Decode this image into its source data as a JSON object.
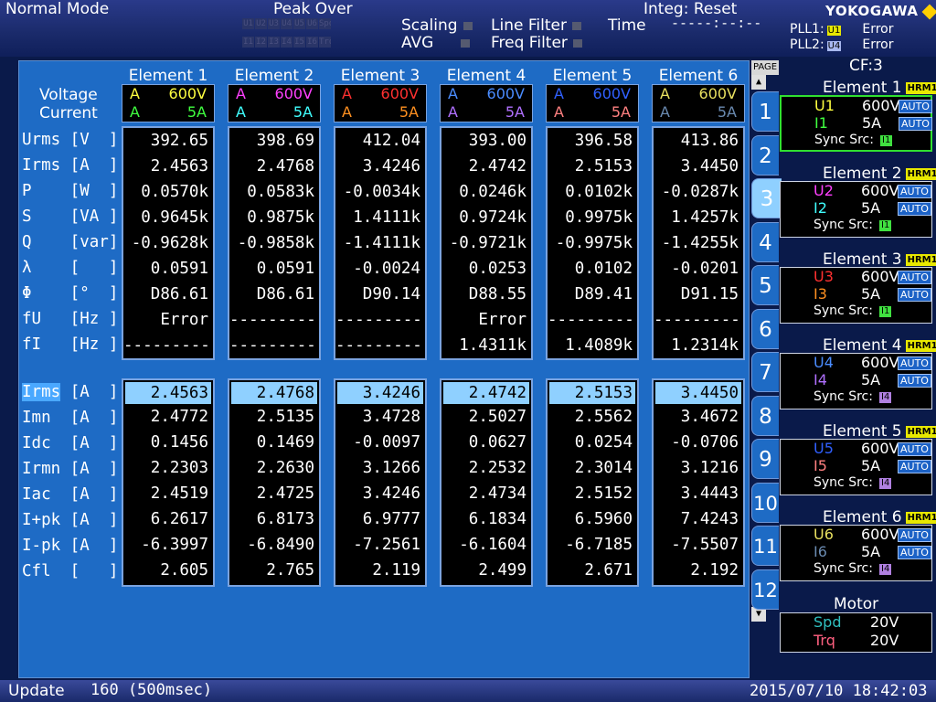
{
  "status": {
    "mode": "Normal Mode",
    "peak_over": "Peak Over",
    "peak_grid_top": [
      "U1",
      "U2",
      "U3",
      "U4",
      "U5",
      "U6",
      "Spd"
    ],
    "peak_grid_bottom": [
      "I1",
      "I2",
      "I3",
      "I4",
      "I5",
      "I6",
      "Trq"
    ],
    "scaling": "Scaling",
    "avg": "AVG",
    "line_filter": "Line Filter",
    "freq_filter": "Freq Filter",
    "integ": "Integ: Reset",
    "time_label": "Time",
    "time_value": "-----:--:--",
    "brand": "YOKOGAWA",
    "pll1_label": "PLL1:",
    "pll1_src": "U1",
    "pll1_status": "Error",
    "pll2_label": "PLL2:",
    "pll2_src": "U4",
    "pll2_status": "Error",
    "cf": "CF:3"
  },
  "header": {
    "voltage": "Voltage",
    "current": "Current"
  },
  "elements": [
    {
      "name": "Element 1",
      "v_label": "A",
      "v_range": "600V",
      "i_label": "A",
      "i_range": "5A",
      "v_color": "#ffff40",
      "i_color": "#40ff40"
    },
    {
      "name": "Element 2",
      "v_label": "A",
      "v_range": "600V",
      "i_label": "A",
      "i_range": "5A",
      "v_color": "#ff40ff",
      "i_color": "#40ffff"
    },
    {
      "name": "Element 3",
      "v_label": "A",
      "v_range": "600V",
      "i_label": "A",
      "i_range": "5A",
      "v_color": "#ff3030",
      "i_color": "#ff9020"
    },
    {
      "name": "Element 4",
      "v_label": "A",
      "v_range": "600V",
      "i_label": "A",
      "i_range": "5A",
      "v_color": "#4a8cff",
      "i_color": "#b070ff"
    },
    {
      "name": "Element 5",
      "v_label": "A",
      "v_range": "600V",
      "i_label": "A",
      "i_range": "5A",
      "v_color": "#3060ff",
      "i_color": "#ff8080"
    },
    {
      "name": "Element 6",
      "v_label": "A",
      "v_range": "600V",
      "i_label": "A",
      "i_range": "5A",
      "v_color": "#e8e060",
      "i_color": "#6a8ab0"
    }
  ],
  "table1": {
    "labels": [
      "Urms [V  ]",
      "Irms [A  ]",
      "P    [W  ]",
      "S    [VA ]",
      "Q    [var]",
      "λ    [   ]",
      "Φ    [°  ]",
      "fU   [Hz ]",
      "fI   [Hz ]"
    ],
    "columns": [
      [
        "392.65",
        "2.4563",
        "0.0570k",
        "0.9645k",
        "-0.9628k",
        "0.0591",
        "D86.61",
        "Error",
        "---------"
      ],
      [
        "398.69",
        "2.4768",
        "0.0583k",
        "0.9875k",
        "-0.9858k",
        "0.0591",
        "D86.61",
        "---------",
        "---------"
      ],
      [
        "412.04",
        "3.4246",
        "-0.0034k",
        "1.4111k",
        "-1.4111k",
        "-0.0024",
        "D90.14",
        "---------",
        "---------"
      ],
      [
        "393.00",
        "2.4742",
        "0.0246k",
        "0.9724k",
        "-0.9721k",
        "0.0253",
        "D88.55",
        "Error",
        "1.4311k"
      ],
      [
        "396.58",
        "2.5153",
        "0.0102k",
        "0.9975k",
        "-0.9975k",
        "0.0102",
        "D89.41",
        "---------",
        "1.4089k"
      ],
      [
        "413.86",
        "3.4450",
        "-0.0287k",
        "1.4257k",
        "-1.4255k",
        "-0.0201",
        "D91.15",
        "---------",
        "1.2314k"
      ]
    ]
  },
  "table2": {
    "labels": [
      "Irms",
      "Imn  [A  ]",
      "Idc  [A  ]",
      "Irmn [A  ]",
      "Iac  [A  ]",
      "I+pk [A  ]",
      "I-pk [A  ]",
      "Cfl  [   ]"
    ],
    "first_label_suffix": " [A  ]",
    "columns": [
      [
        "2.4563",
        "2.4772",
        "0.1456",
        "2.2303",
        "2.4519",
        "6.2617",
        "-6.3997",
        "2.605"
      ],
      [
        "2.4768",
        "2.5135",
        "0.1469",
        "2.2630",
        "2.4725",
        "6.8173",
        "-6.8490",
        "2.765"
      ],
      [
        "3.4246",
        "3.4728",
        "-0.0097",
        "3.1266",
        "3.4246",
        "6.9777",
        "-7.2561",
        "2.119"
      ],
      [
        "2.4742",
        "2.5027",
        "0.0627",
        "2.2532",
        "2.4734",
        "6.1834",
        "-6.1604",
        "2.499"
      ],
      [
        "2.5153",
        "2.5562",
        "0.0254",
        "2.3014",
        "2.5152",
        "6.5960",
        "-6.7185",
        "2.671"
      ],
      [
        "3.4450",
        "3.4672",
        "-0.0706",
        "3.1216",
        "3.4443",
        "7.4243",
        "-7.5507",
        "2.192"
      ]
    ]
  },
  "pages": {
    "label": "PAGE",
    "items": [
      "1",
      "2",
      "3",
      "4",
      "5",
      "6",
      "7",
      "8",
      "9",
      "10",
      "11",
      "12"
    ],
    "active": "3"
  },
  "side_elements": [
    {
      "title": "Element 1",
      "harm": "HRM1",
      "u": "U1",
      "u_range": "600V",
      "i": "I1",
      "i_range": "5A",
      "auto": "AUTO",
      "sync": "Sync Src:",
      "sync_src": "I1",
      "u_color": "#ffff40",
      "i_color": "#40ff40",
      "src_color": "#40e040"
    },
    {
      "title": "Element 2",
      "harm": "HRM1",
      "u": "U2",
      "u_range": "600V",
      "i": "I2",
      "i_range": "5A",
      "auto": "AUTO",
      "sync": "Sync Src:",
      "sync_src": "I1",
      "u_color": "#ff40ff",
      "i_color": "#40ffff",
      "src_color": "#40e040"
    },
    {
      "title": "Element 3",
      "harm": "HRM1",
      "u": "U3",
      "u_range": "600V",
      "i": "I3",
      "i_range": "5A",
      "auto": "AUTO",
      "sync": "Sync Src:",
      "sync_src": "I1",
      "u_color": "#ff3030",
      "i_color": "#ff9020",
      "src_color": "#40e040"
    },
    {
      "title": "Element 4",
      "harm": "HRM1",
      "u": "U4",
      "u_range": "600V",
      "i": "I4",
      "i_range": "5A",
      "auto": "AUTO",
      "sync": "Sync Src:",
      "sync_src": "I4",
      "u_color": "#4a8cff",
      "i_color": "#b070ff",
      "src_color": "#b080e0"
    },
    {
      "title": "Element 5",
      "harm": "HRM1",
      "u": "U5",
      "u_range": "600V",
      "i": "I5",
      "i_range": "5A",
      "auto": "AUTO",
      "sync": "Sync Src:",
      "sync_src": "I4",
      "u_color": "#3060ff",
      "i_color": "#ff8080",
      "src_color": "#b080e0"
    },
    {
      "title": "Element 6",
      "harm": "HRM1",
      "u": "U6",
      "u_range": "600V",
      "i": "I6",
      "i_range": "5A",
      "auto": "AUTO",
      "sync": "Sync Src:",
      "sync_src": "I4",
      "u_color": "#e8e060",
      "i_color": "#6a8ab0",
      "src_color": "#b080e0"
    }
  ],
  "motor": {
    "title": "Motor",
    "spd": "Spd",
    "spd_range": "20V",
    "trq": "Trq",
    "trq_range": "20V",
    "spd_color": "#30c0c0",
    "trq_color": "#ff6080"
  },
  "footer": {
    "update_label": "Update",
    "update_value": "160 (500msec)",
    "datetime": "2015/07/10 18:42:03"
  }
}
